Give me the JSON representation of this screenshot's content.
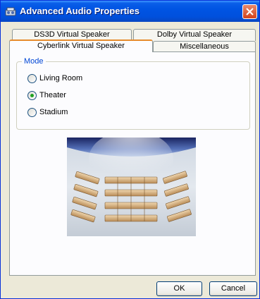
{
  "window": {
    "title": "Advanced Audio Properties",
    "icon": "speaker-app-icon",
    "close_icon": "close-icon"
  },
  "tabs": {
    "back_row": [
      "DS3D Virtual Speaker",
      "Dolby Virtual Speaker"
    ],
    "front_row": [
      "Cyberlink Virtual Speaker",
      "Miscellaneous"
    ],
    "active": "Cyberlink Virtual Speaker"
  },
  "mode": {
    "label": "Mode",
    "options": [
      {
        "label": "Living Room",
        "selected": false
      },
      {
        "label": "Theater",
        "selected": true
      },
      {
        "label": "Stadium",
        "selected": false
      }
    ]
  },
  "preview": {
    "image": "theater-seating-illustration"
  },
  "buttons": {
    "ok": "OK",
    "cancel": "Cancel"
  },
  "colors": {
    "title_bar": "#0054e3",
    "active_tab_accent": "#e68b2c",
    "group_label": "#0046d5",
    "radio_selected": "#21a121"
  }
}
